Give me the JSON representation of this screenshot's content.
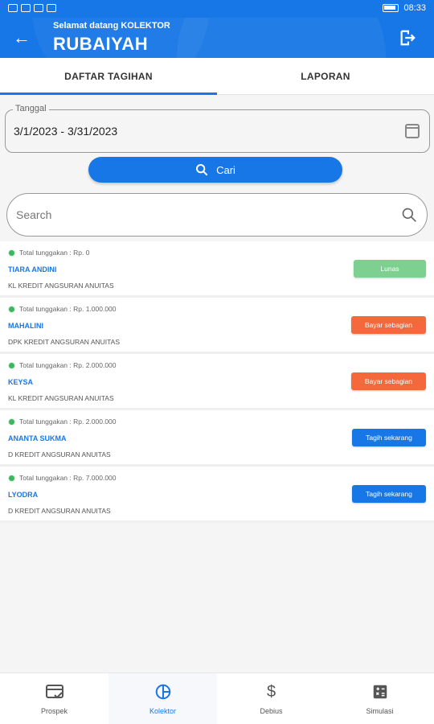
{
  "status_bar": {
    "time": "08:33"
  },
  "header": {
    "greeting": "Selamat datang KOLEKTOR",
    "user_name": "RUBAIYAH"
  },
  "tabs": [
    {
      "label": "DAFTAR TAGIHAN",
      "active": true
    },
    {
      "label": "LAPORAN",
      "active": false
    }
  ],
  "date_filter": {
    "label": "Tanggal",
    "value": "3/1/2023 - 3/31/2023"
  },
  "search_button": {
    "label": "Cari"
  },
  "search": {
    "placeholder": "Search"
  },
  "items": [
    {
      "total": "Total tunggakan : Rp. 0",
      "name": "TIARA ANDINI",
      "product": "KL  KREDIT ANGSURAN ANUITAS",
      "action": "Lunas",
      "action_color": "#7dd08f"
    },
    {
      "total": "Total tunggakan : Rp. 1.000.000",
      "name": "MAHALINI",
      "product": "DPK  KREDIT ANGSURAN ANUITAS",
      "action": "Bayar sebagian",
      "action_color": "#f4683c"
    },
    {
      "total": "Total tunggakan : Rp. 2.000.000",
      "name": "KEYSA",
      "product": "KL  KREDIT ANGSURAN ANUITAS",
      "action": "Bayar sebagian",
      "action_color": "#f4683c"
    },
    {
      "total": "Total tunggakan : Rp. 2.000.000",
      "name": "ANANTA SUKMA",
      "product": "D  KREDIT ANGSURAN ANUITAS",
      "action": "Tagih sekarang",
      "action_color": "#1877e6"
    },
    {
      "total": "Total tunggakan : Rp. 7.000.000",
      "name": "LYODRA",
      "product": "D  KREDIT ANGSURAN ANUITAS",
      "action": "Tagih sekarang",
      "action_color": "#1877e6"
    }
  ],
  "bottom_nav": [
    {
      "label": "Prospek",
      "icon": "card-check-icon",
      "active": false
    },
    {
      "label": "Kolektor",
      "icon": "pie-chart-icon",
      "active": true
    },
    {
      "label": "Debius",
      "icon": "dollar-icon",
      "active": false
    },
    {
      "label": "Simulasi",
      "icon": "calculator-icon",
      "active": false
    }
  ],
  "colors": {
    "primary": "#1877e6",
    "paid": "#7dd08f",
    "partial": "#f4683c",
    "status_dot": "#3bb75e"
  }
}
